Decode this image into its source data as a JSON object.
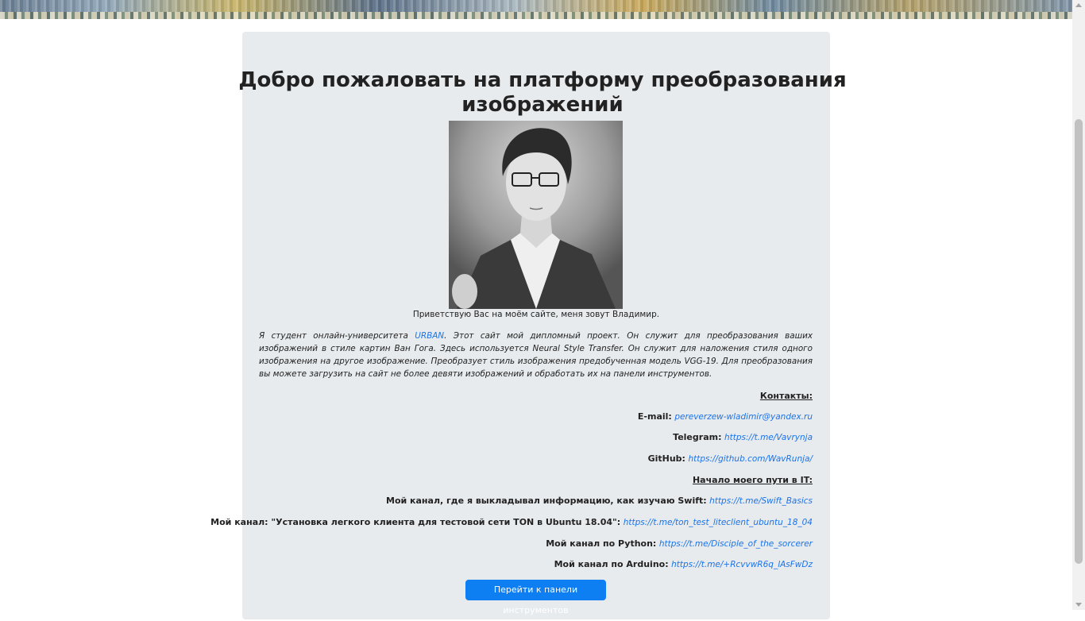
{
  "header": {
    "title_line1": "Добро пожаловать на платформу преобразования",
    "title_line2": "изображений"
  },
  "portrait": {
    "caption": "Приветствую Вас на моём сайте, меня зовут Владимир."
  },
  "intro": {
    "part1": "Я студент онлайн-университета ",
    "link": "URBAN",
    "part2": ". Этот сайт мой дипломный проект. Он служит для преобразования ваших изображений в стиле картин Ван Гога. Здесь используется Neural Style Transfer. Он служит для наложения стиля одного изображения на другое изображение. Преобразует стиль изображения предобученная модель VGG-19. Для преобразования вы можете загрузить на сайт не более девяти изображений и обработать их на панели инструментов."
  },
  "contacts": {
    "heading": "Контакты:",
    "email_label": "E-mail:",
    "email": "pereverzew-wladimir@yandex.ru",
    "telegram_label": "Telegram:",
    "telegram": "https://t.me/Vavrynja",
    "github_label": "GitHub:",
    "github": "https://github.com/WavRunja/"
  },
  "journey": {
    "heading": "Начало моего пути в IT:",
    "items": [
      {
        "label": "Мой канал, где я выкладывал информацию, как изучаю Swift:",
        "link": "https://t.me/Swift_Basics"
      },
      {
        "label": "Мой канал: \"Установка легкого клиента для тестовой сети TON в Ubuntu 18.04\":",
        "link": "https://t.me/ton_test_liteclient_ubuntu_18_04"
      },
      {
        "label": "Мой канал по Python:",
        "link": "https://t.me/Disciple_of_the_sorcerer"
      },
      {
        "label": "Мой канал по Arduino:",
        "link": "https://t.me/+RcvvwR6q_lAsFwDz"
      }
    ]
  },
  "cta": {
    "label": "Перейти к панели инструментов"
  },
  "colors": {
    "accent": "#0d7ff2",
    "link": "#1a73e8",
    "card": "#e8ebee"
  }
}
